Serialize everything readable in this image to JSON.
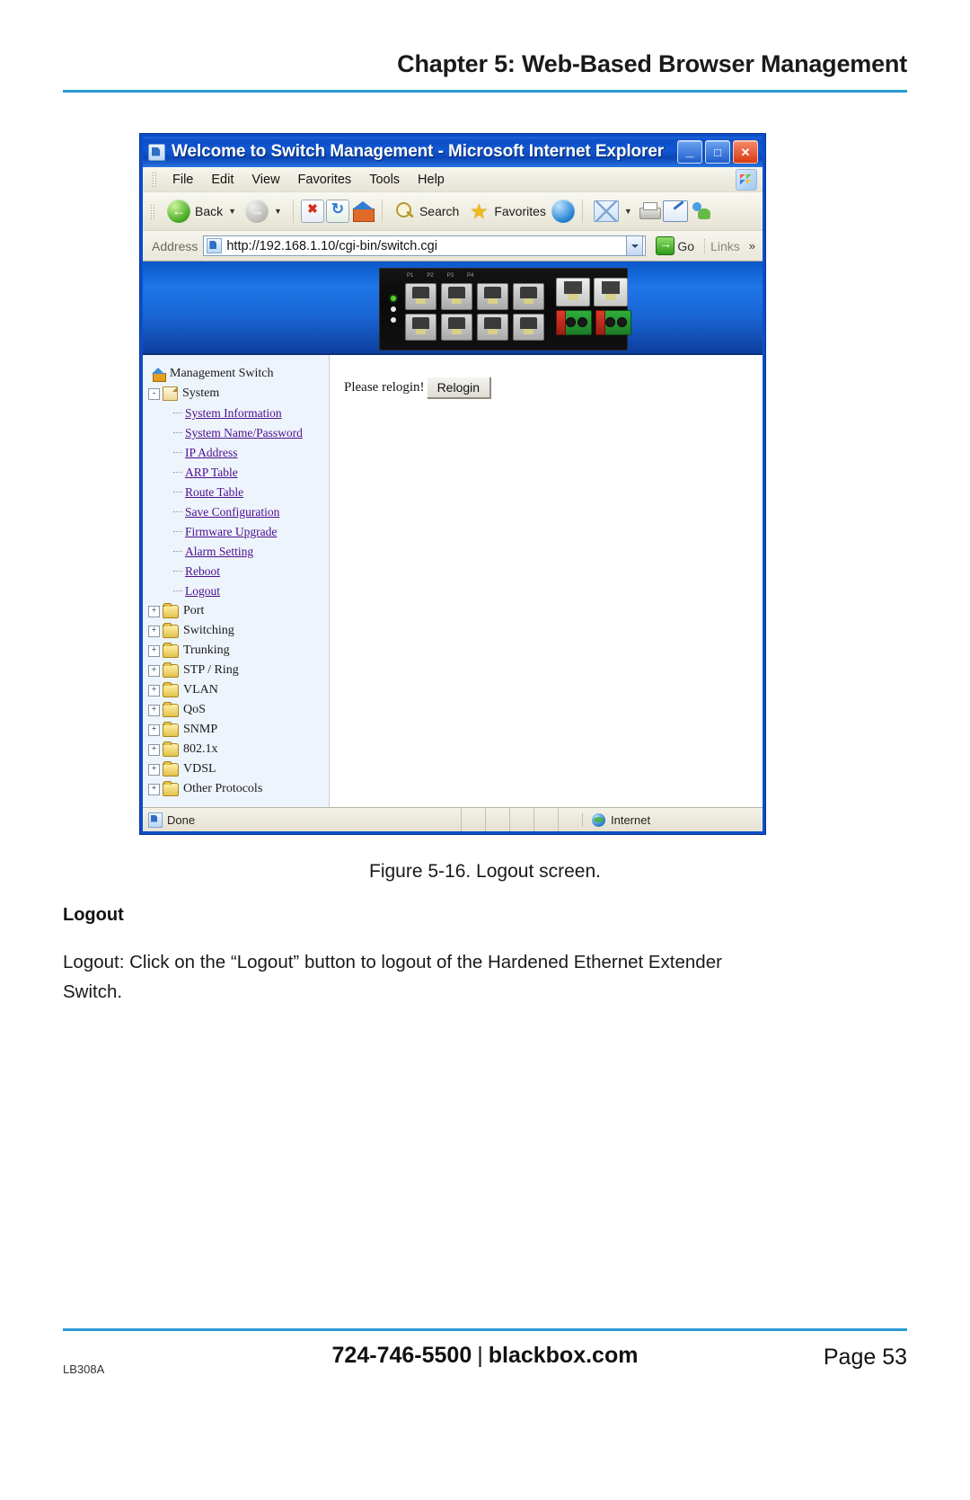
{
  "document": {
    "header_title": "Chapter 5: Web-Based Browser Management",
    "figure_caption": "Figure 5-16. Logout screen.",
    "section_heading": "Logout",
    "body_paragraph": "Logout: Click on the “Logout” button to logout of the Hardened Ethernet Extender Switch.",
    "accent_color": "#2c9ad4"
  },
  "footer": {
    "model_code": "LB308A",
    "phone": "724-746-5500",
    "separator": "|",
    "website": "blackbox.com",
    "page_label": "Page 53"
  },
  "browser": {
    "title": "Welcome to Switch Management - Microsoft Internet Explorer",
    "window_buttons": {
      "minimize": "_",
      "maximize": "□",
      "close": "✕"
    },
    "menu": [
      "File",
      "Edit",
      "View",
      "Favorites",
      "Tools",
      "Help"
    ],
    "toolbar": {
      "back": "Back",
      "search": "Search",
      "favorites": "Favorites"
    },
    "address": {
      "label": "Address",
      "url": "http://192.168.1.10/cgi-bin/switch.cgi",
      "go": "Go",
      "links": "Links",
      "chevron": "»"
    },
    "status": {
      "left": "Done",
      "zone": "Internet"
    }
  },
  "tree": {
    "root": "Management Switch",
    "system_group": "System",
    "system_items": [
      "System Information",
      "System Name/Password",
      "IP Address",
      "ARP Table",
      "Route Table",
      "Save Configuration",
      "Firmware Upgrade",
      "Alarm Setting",
      "Reboot",
      "Logout"
    ],
    "folders": [
      "Port",
      "Switching",
      "Trunking",
      "STP / Ring",
      "VLAN",
      "QoS",
      "SNMP",
      "802.1x",
      "VDSL",
      "Other Protocols"
    ],
    "expand_glyph": "+",
    "collapse_glyph": "-"
  },
  "content": {
    "message": "Please relogin!",
    "relogin_button": "Relogin"
  },
  "device_banner": {
    "port_labels": [
      "P1",
      "P2",
      "P3",
      "P4"
    ]
  }
}
